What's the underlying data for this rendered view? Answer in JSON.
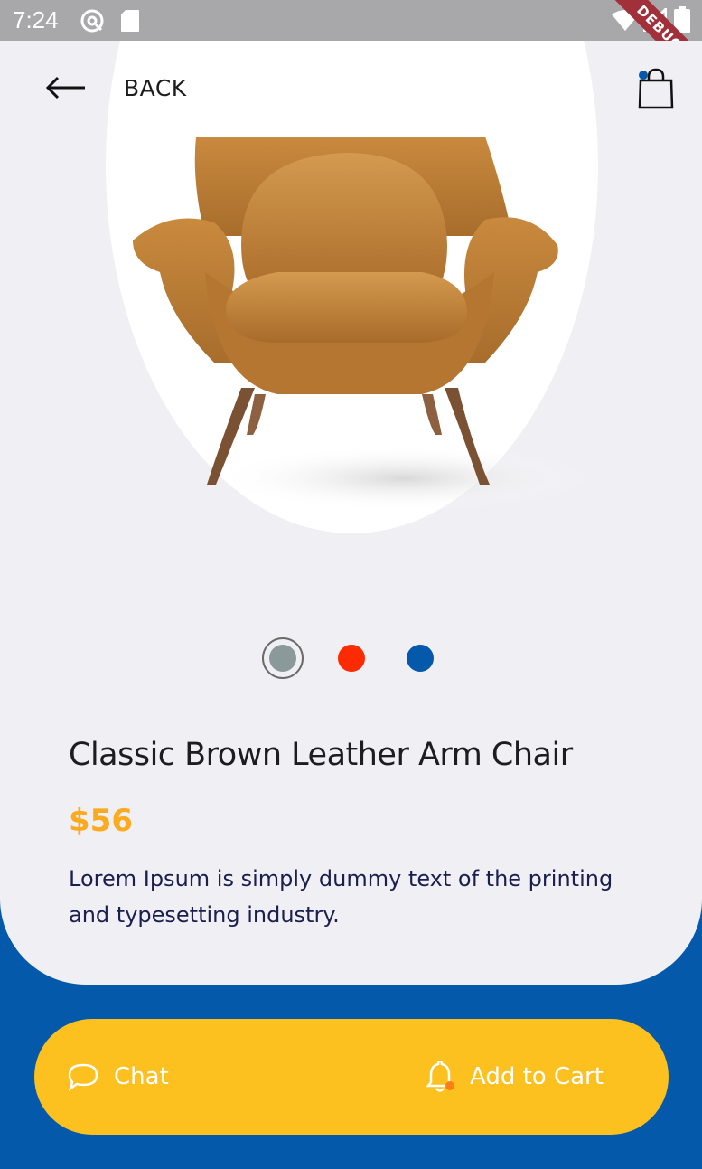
{
  "status_bar": {
    "time": "7:24",
    "icons": [
      "at-sign-icon",
      "sd-card-icon",
      "wifi-icon",
      "signal-icon",
      "battery-icon"
    ],
    "debug_label": "DEBUG"
  },
  "appbar": {
    "back_label": "BACK",
    "back_icon": "arrow-left-icon",
    "bag_icon": "shopping-bag-icon"
  },
  "product": {
    "image": "brown-armchair",
    "color_options": [
      {
        "name": "grey",
        "hex": "#8a9a9a",
        "selected": true
      },
      {
        "name": "red",
        "hex": "#fd2b03",
        "selected": false
      },
      {
        "name": "blue",
        "hex": "#0459aa",
        "selected": false
      }
    ],
    "title": "Classic Brown Leather Arm Chair",
    "price": "$56",
    "description": "Lorem Ipsum is simply dummy text of the printing and typesetting industry."
  },
  "actions": {
    "chat_label": "Chat",
    "cart_label": "Add to Cart"
  },
  "colors": {
    "primary_blue": "#0459aa",
    "accent_yellow": "#fcc01f",
    "price_orange": "#fcaa1e",
    "background": "#f0eff3"
  }
}
